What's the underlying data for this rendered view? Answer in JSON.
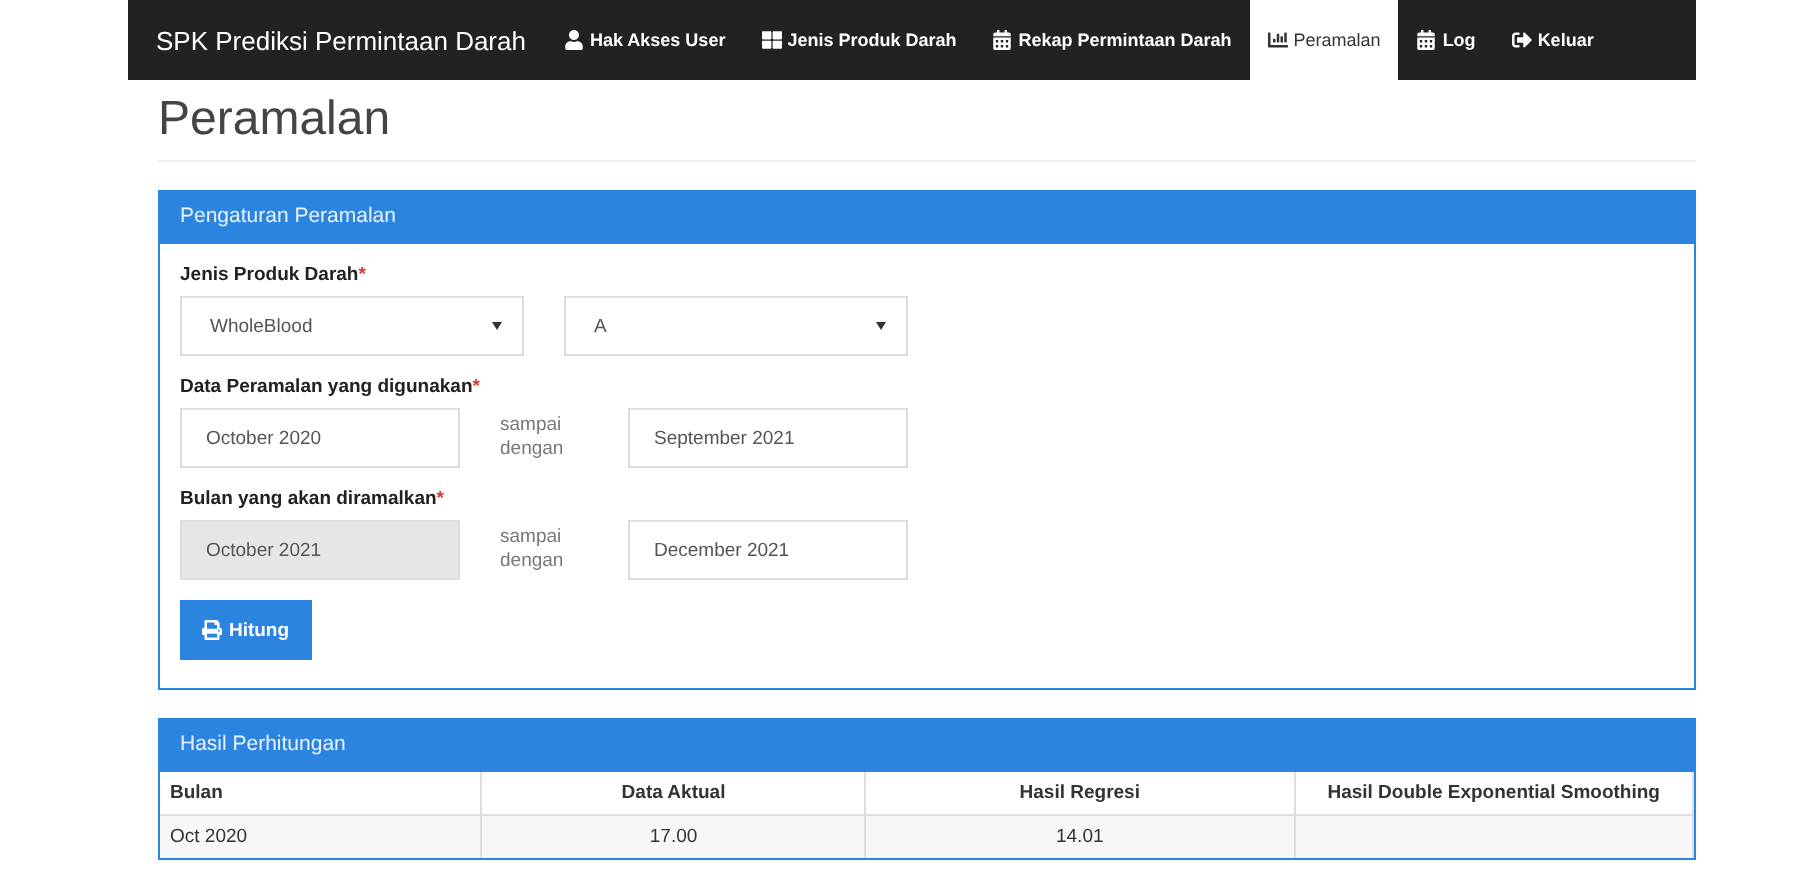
{
  "navbar": {
    "brand": "SPK Prediksi Permintaan Darah",
    "items": [
      {
        "label": "Hak Akses User",
        "kind": "user",
        "selected": false
      },
      {
        "label": "Jenis Produk Darah",
        "kind": "grid",
        "selected": false
      },
      {
        "label": "Rekap Permintaan Darah",
        "kind": "calendar",
        "selected": false
      },
      {
        "label": "Peramalan",
        "kind": "chart",
        "selected": true
      },
      {
        "label": "Log",
        "kind": "calendar",
        "selected": false
      },
      {
        "label": "Keluar",
        "kind": "logout",
        "selected": false
      }
    ]
  },
  "page_title": "Peramalan",
  "settings_panel": {
    "title": "Pengaturan Peramalan",
    "product": {
      "label": "Jenis Produk Darah",
      "required_mark": "*",
      "selects": [
        "WholeBlood",
        "A"
      ]
    },
    "data_range": {
      "label": "Data Peramalan yang digunakan",
      "required_mark": "*",
      "from": {
        "value": "October 2020",
        "disabled": false
      },
      "separator": "sampai dengan",
      "to": {
        "value": "September 2021",
        "disabled": false
      }
    },
    "forecast_range": {
      "label": "Bulan yang akan diramalkan",
      "required_mark": "*",
      "from": {
        "value": "October 2021",
        "disabled": true
      },
      "separator": "sampai dengan",
      "to": {
        "value": "December 2021",
        "disabled": false
      }
    },
    "button": "Hitung"
  },
  "results_panel": {
    "title": "Hasil Perhitungan",
    "columns": [
      "Bulan",
      "Data Aktual",
      "Hasil Regresi",
      "Hasil Double Exponential Smoothing"
    ],
    "rows": [
      [
        "Oct 2020",
        "17.00",
        "14.01",
        ""
      ]
    ]
  }
}
